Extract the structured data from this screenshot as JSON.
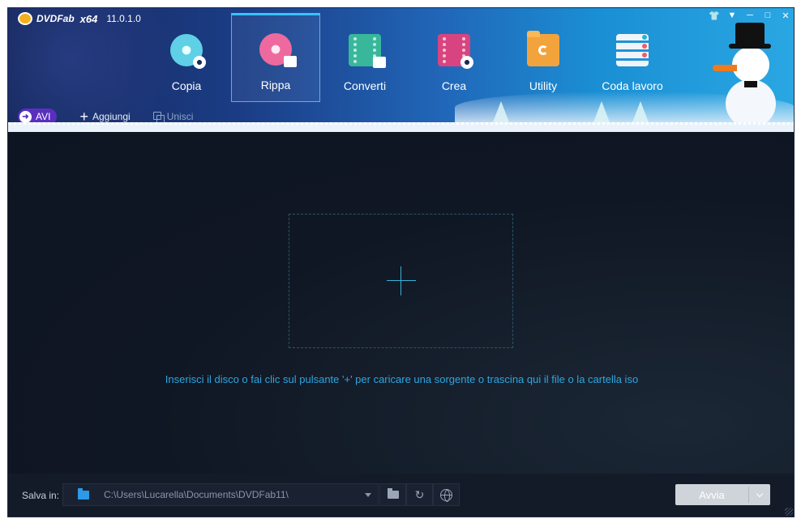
{
  "app": {
    "name": "DVDFab",
    "arch": "x64",
    "version": "11.0.1.0"
  },
  "window_controls": [
    "shirt-icon",
    "menu-icon",
    "minimize-icon",
    "maximize-icon",
    "close-icon"
  ],
  "nav": [
    {
      "label": "Copia",
      "icon": "disc-copy-icon",
      "active": false
    },
    {
      "label": "Rippa",
      "icon": "disc-rip-icon",
      "active": true
    },
    {
      "label": "Converti",
      "icon": "film-convert-icon",
      "active": false
    },
    {
      "label": "Crea",
      "icon": "film-create-icon",
      "active": false
    },
    {
      "label": "Utility",
      "icon": "folder-utility-icon",
      "active": false
    },
    {
      "label": "Coda lavoro",
      "icon": "task-queue-icon",
      "active": false
    }
  ],
  "toolbar": {
    "format_label": "AVI",
    "add_label": "Aggiungi",
    "merge_label": "Unisci"
  },
  "main": {
    "hint": "Inserisci il disco o fai clic sul pulsante '+' per caricare una sorgente o trascina qui il file o la cartella iso"
  },
  "footer": {
    "save_label": "Salva in:",
    "path": "C:\\Users\\Lucarella\\Documents\\DVDFab11\\",
    "start_label": "Avvia"
  },
  "colors": {
    "accent": "#2fa5df",
    "format_badge": "#5a2fc0",
    "background": "#111826"
  }
}
